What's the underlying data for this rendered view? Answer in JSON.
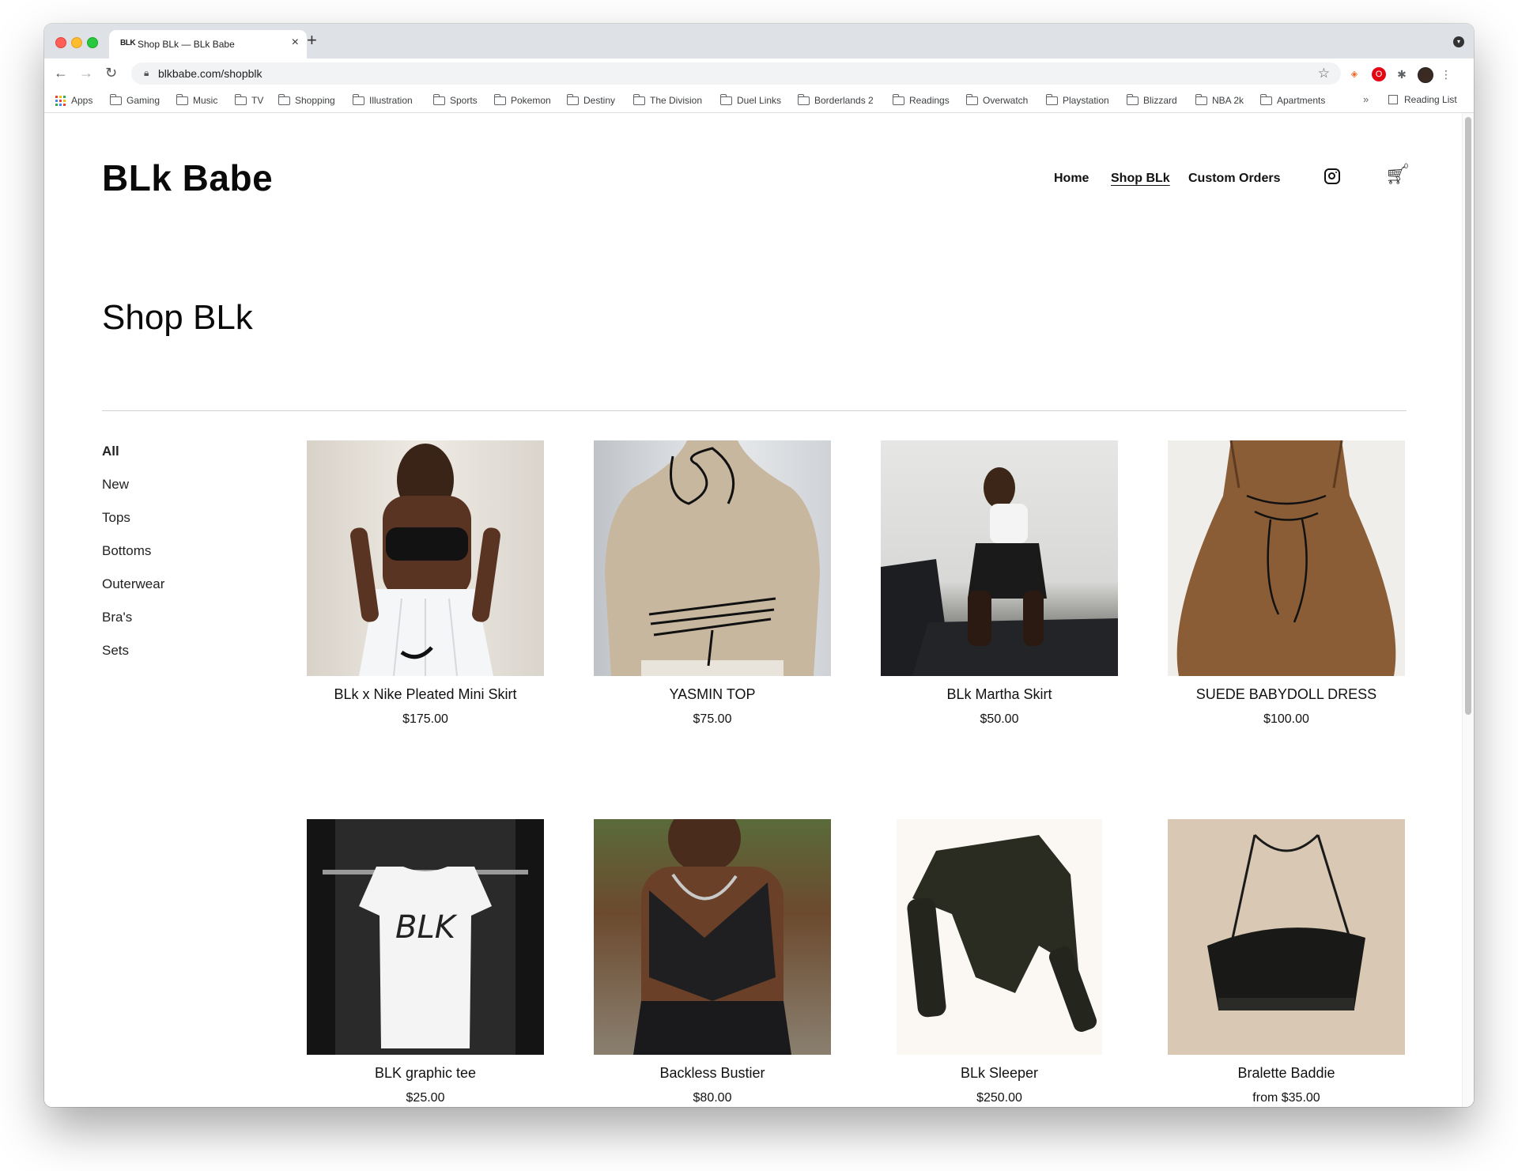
{
  "browser": {
    "tab": {
      "favicon_text": "BLK",
      "title": "Shop BLk — BLk Babe",
      "close": "×"
    },
    "new_tab": "+",
    "url": "blkbabe.com/shopblk",
    "bookmarks": [
      "Apps",
      "Gaming",
      "Music",
      "TV",
      "Shopping",
      "Illustration",
      "Sports",
      "Pokemon",
      "Destiny",
      "The Division",
      "Duel Links",
      "Borderlands 2",
      "Readings",
      "Overwatch",
      "Playstation",
      "Blizzard",
      "NBA 2k",
      "Apartments"
    ],
    "bookmarks_overflow": "»",
    "reading_list": "Reading List"
  },
  "site": {
    "logo": "BLk Babe",
    "nav": {
      "home": "Home",
      "shop": "Shop BLk",
      "custom": "Custom Orders"
    },
    "cart_count": "0"
  },
  "page": {
    "title": "Shop BLk",
    "categories": [
      "All",
      "New",
      "Tops",
      "Bottoms",
      "Outerwear",
      "Bra's",
      "Sets"
    ],
    "products": [
      {
        "name": "BLk x Nike Pleated Mini Skirt",
        "price": "$175.00"
      },
      {
        "name": "YASMIN TOP",
        "price": "$75.00"
      },
      {
        "name": "BLk Martha Skirt",
        "price": "$50.00"
      },
      {
        "name": "SUEDE BABYDOLL DRESS",
        "price": "$100.00"
      },
      {
        "name": "BLK graphic tee",
        "price": "$25.00",
        "print": "BLK"
      },
      {
        "name": "Backless Bustier",
        "price": "$80.00"
      },
      {
        "name": "BLk Sleeper",
        "price": "$250.00"
      },
      {
        "name": "Bralette Baddie",
        "price": "from $35.00"
      }
    ]
  }
}
